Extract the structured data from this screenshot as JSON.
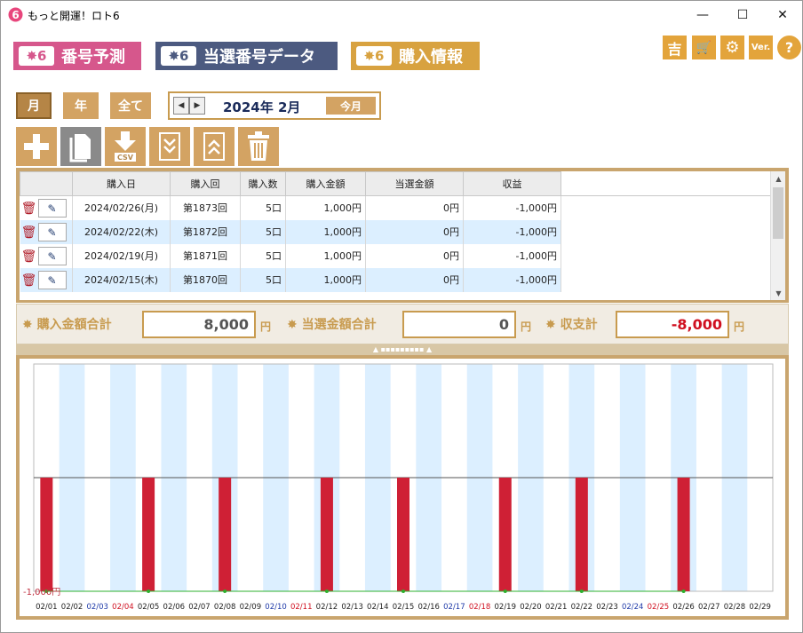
{
  "window": {
    "title": "もっと開運！ロト6",
    "min": "—",
    "max": "☐",
    "close": "✕"
  },
  "main_tabs": [
    {
      "badge": "✸6",
      "label": "番号予測"
    },
    {
      "badge": "✸6",
      "label": "当選番号データ"
    },
    {
      "badge": "✸6",
      "label": "購入情報"
    }
  ],
  "top_icons": [
    {
      "name": "fortune-icon",
      "glyph": "吉"
    },
    {
      "name": "cart-icon",
      "glyph": "🛒"
    },
    {
      "name": "gear-icon",
      "glyph": "⚙"
    },
    {
      "name": "version-icon",
      "glyph": "Ver."
    },
    {
      "name": "help-icon",
      "glyph": "?"
    }
  ],
  "period": {
    "month": "月",
    "year": "年",
    "all": "全て",
    "prev": "◀",
    "next": "▶",
    "current": "2024年 2月",
    "today": "今月"
  },
  "toolbar": [
    {
      "name": "add-icon",
      "label": "add"
    },
    {
      "name": "copy-icon",
      "label": "copy"
    },
    {
      "name": "csv-download-icon",
      "label": "CSV"
    },
    {
      "name": "scroll-bottom-icon",
      "label": "down"
    },
    {
      "name": "scroll-top-icon",
      "label": "up"
    },
    {
      "name": "trash-icon",
      "label": "delete"
    }
  ],
  "table": {
    "headers": [
      "購入日",
      "購入回",
      "購入数",
      "購入金額",
      "当選金額",
      "収益"
    ],
    "rows": [
      {
        "date": "2024/02/26(月)",
        "round": "第1873回",
        "count": "5口",
        "amount": "1,000円",
        "win": "0円",
        "profit": "-1,000円"
      },
      {
        "date": "2024/02/22(木)",
        "round": "第1872回",
        "count": "5口",
        "amount": "1,000円",
        "win": "0円",
        "profit": "-1,000円"
      },
      {
        "date": "2024/02/19(月)",
        "round": "第1871回",
        "count": "5口",
        "amount": "1,000円",
        "win": "0円",
        "profit": "-1,000円"
      },
      {
        "date": "2024/02/15(木)",
        "round": "第1870回",
        "count": "5口",
        "amount": "1,000円",
        "win": "0円",
        "profit": "-1,000円"
      }
    ]
  },
  "totals": {
    "purchase_label": "購入金額合計",
    "purchase_value": "8,000",
    "purchase_unit": "円",
    "win_label": "当選金額合計",
    "win_value": "0",
    "win_unit": "円",
    "balance_label": "収支計",
    "balance_value": "-8,000",
    "balance_unit": "円"
  },
  "chart_data": {
    "type": "bar",
    "ylabel_tick": "-1,000円",
    "categories": [
      "02/01",
      "02/02",
      "02/03",
      "02/04",
      "02/05",
      "02/06",
      "02/07",
      "02/08",
      "02/09",
      "02/10",
      "02/11",
      "02/12",
      "02/13",
      "02/14",
      "02/15",
      "02/16",
      "02/17",
      "02/18",
      "02/19",
      "02/20",
      "02/21",
      "02/22",
      "02/23",
      "02/24",
      "02/25",
      "02/26",
      "02/27",
      "02/28",
      "02/29"
    ],
    "category_colors": [
      "#222",
      "#222",
      "#1f3aa8",
      "#d01020",
      "#222",
      "#222",
      "#222",
      "#222",
      "#222",
      "#1f3aa8",
      "#d01020",
      "#222",
      "#222",
      "#222",
      "#222",
      "#222",
      "#1f3aa8",
      "#d01020",
      "#222",
      "#222",
      "#222",
      "#222",
      "#222",
      "#1f3aa8",
      "#d01020",
      "#222",
      "#222",
      "#222",
      "#222"
    ],
    "values": [
      -1000,
      0,
      0,
      0,
      -1000,
      0,
      0,
      -1000,
      0,
      0,
      0,
      -1000,
      0,
      0,
      -1000,
      0,
      0,
      0,
      -1000,
      0,
      0,
      -1000,
      0,
      0,
      0,
      -1000,
      0,
      0,
      0
    ],
    "cumulative_line_color": "#2db02d",
    "bar_color": "#cf2035",
    "ylim": [
      -1000,
      1000
    ]
  }
}
